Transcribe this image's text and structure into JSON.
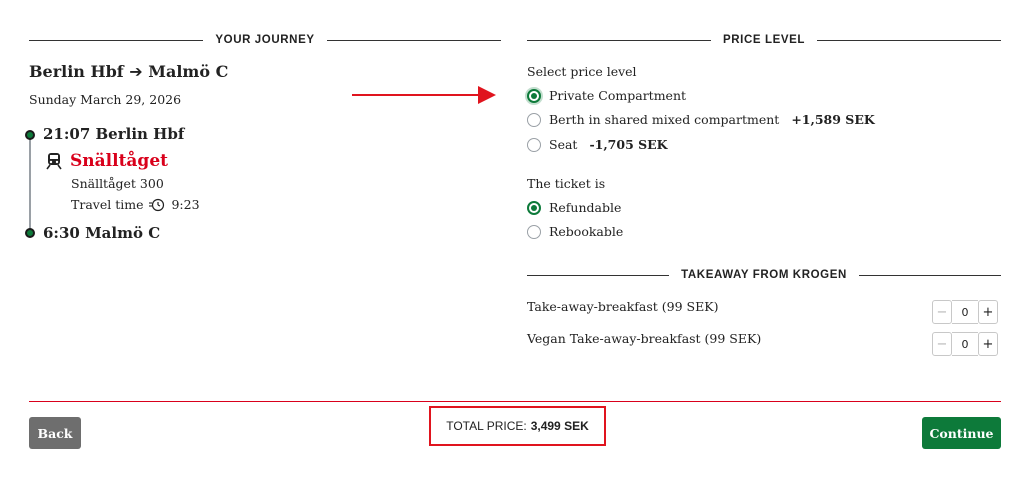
{
  "journey": {
    "header": "YOUR JOURNEY",
    "route_from": "Berlin Hbf",
    "route_to": "Malmö C",
    "date": "Sunday March 29, 2026",
    "departure": "21:07 Berlin Hbf",
    "operator": "Snälltåget",
    "train_number": "Snälltåget 300",
    "travel_time_label": "Travel time",
    "travel_time_value": "9:23",
    "arrival": "6:30 Malmö C"
  },
  "price_level": {
    "header": "PRICE LEVEL",
    "select_label": "Select price level",
    "options": [
      {
        "label": "Private Compartment",
        "price": "",
        "selected": true
      },
      {
        "label": "Berth in shared mixed compartment",
        "price": "+1,589 SEK",
        "selected": false
      },
      {
        "label": "Seat",
        "price": "-1,705 SEK",
        "selected": false
      }
    ],
    "ticket_label": "The ticket is",
    "ticket_options": [
      {
        "label": "Refundable",
        "selected": true
      },
      {
        "label": "Rebookable",
        "selected": false
      }
    ]
  },
  "takeaway": {
    "header": "TAKEAWAY FROM KROGEN",
    "items": [
      {
        "label": "Take-away-breakfast (99 SEK)",
        "qty": "0",
        "minus": "−",
        "plus": "+"
      },
      {
        "label": "Vegan Take-away-breakfast (99 SEK)",
        "qty": "0",
        "minus": "−",
        "plus": "+"
      }
    ]
  },
  "footer": {
    "back_label": "Back",
    "total_label": "TOTAL PRICE:",
    "total_amount": "3,499 SEK",
    "continue_label": "Continue"
  },
  "colors": {
    "accent_green": "#0d7a3a",
    "operator_red": "#d9001b",
    "annotation_red": "#e0141e"
  },
  "icons": {
    "route_arrow": "arrow-right-icon",
    "train": "train-icon",
    "clock": "clock-icon"
  }
}
